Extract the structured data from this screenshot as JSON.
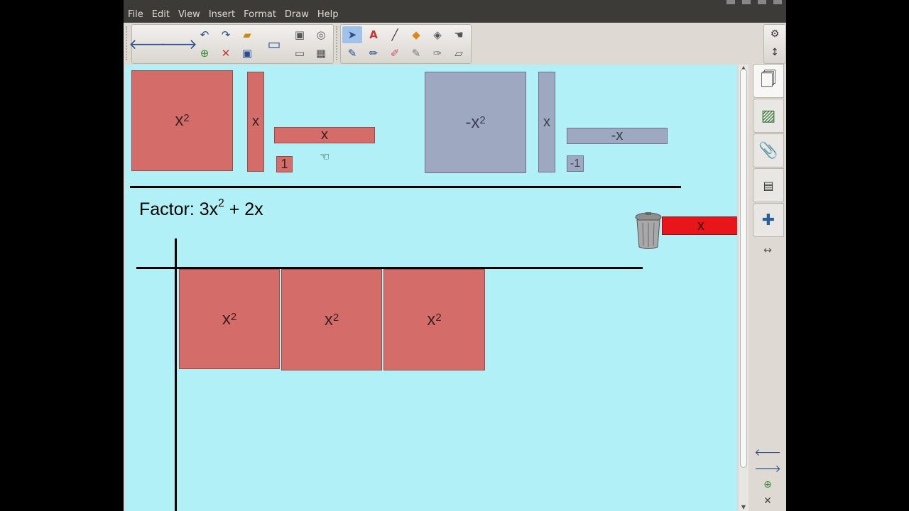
{
  "menu": [
    "File",
    "Edit",
    "View",
    "Insert",
    "Format",
    "Draw",
    "Help"
  ],
  "toolbar": {
    "nav_icons": [
      "back-arrow-icon",
      "forward-arrow-icon"
    ],
    "edit_icons": [
      "undo-icon",
      "redo-icon",
      "open-folder-icon",
      "new-page-icon",
      "delete-icon",
      "save-icon"
    ],
    "display_icons": [
      "screen-icon",
      "screenshot-icon",
      "search-icon",
      "screen-shade-icon",
      "table-icon"
    ],
    "draw_icons": [
      "select-icon",
      "text-icon",
      "line-icon",
      "shapes-icon",
      "fill-icon",
      "pen-icon",
      "highlighter-icon",
      "brush-icon",
      "creative-pen-icon",
      "magic-pen-icon",
      "calligraphy-icon",
      "eraser-icon"
    ]
  },
  "sidebar": {
    "top_icons": [
      "gear-icon",
      "move-icon"
    ],
    "tabs": [
      "page-sorter-icon",
      "gallery-icon",
      "attachments-icon",
      "properties-icon",
      "addons-icon"
    ],
    "bottom_icons": [
      "expand-icon",
      "previous-page-icon",
      "next-page-icon",
      "add-page-icon",
      "close-icon"
    ]
  },
  "tiles": {
    "x2_label": "x",
    "x2_exp": "2",
    "x_label": "x",
    "one_label": "1",
    "neg_x2_label": "-x",
    "neg_x2_exp": "2",
    "neg_x_label": "-x",
    "neg_one_label": "-1",
    "dragged_x_label": "x"
  },
  "problem": {
    "prefix": "Factor: 3x",
    "exp": "2",
    "suffix": " + 2x"
  },
  "colors": {
    "positive_tile": "#d46d6a",
    "negative_tile": "#9ea8c0",
    "highlight_tile": "#e8151b",
    "canvas": "#b0f0f6"
  }
}
